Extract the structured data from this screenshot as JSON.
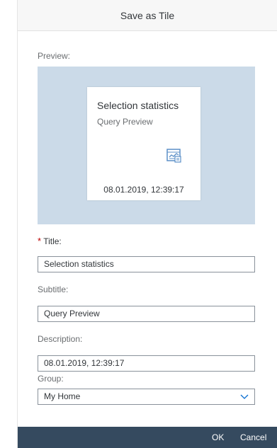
{
  "dialog": {
    "title": "Save as Tile"
  },
  "preview": {
    "label": "Preview:",
    "tile": {
      "title": "Selection statistics",
      "subtitle": "Query Preview",
      "icon": "chart-document-icon",
      "footer": "08.01.2019, 12:39:17"
    },
    "background_color": "#cbdae8"
  },
  "form": {
    "title_required_mark": "*",
    "title_label": "Title:",
    "title_value": "Selection statistics",
    "subtitle_label": "Subtitle:",
    "subtitle_value": "Query Preview",
    "description_label": "Description:",
    "description_value": "08.01.2019, 12:39:17",
    "group_label": "Group:",
    "group_value": "My Home"
  },
  "footer": {
    "ok_label": "OK",
    "cancel_label": "Cancel",
    "background_color": "#354a5f"
  }
}
